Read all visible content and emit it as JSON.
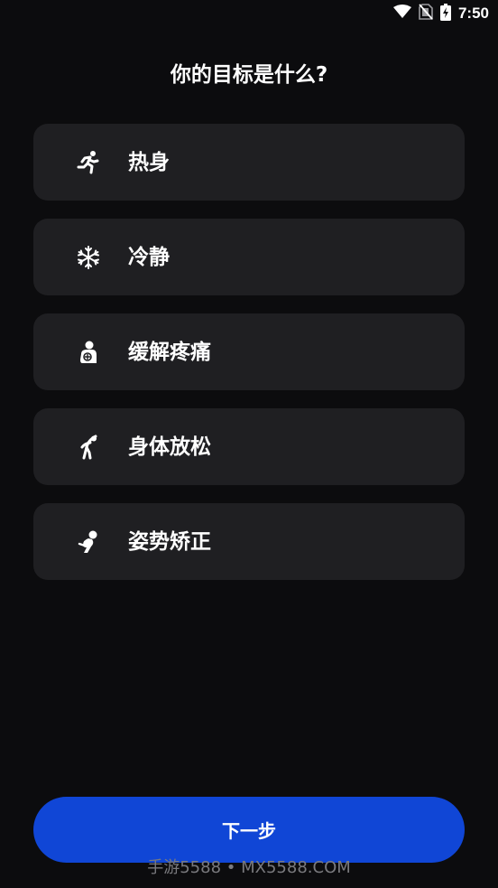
{
  "status_bar": {
    "time": "7:50",
    "icons": [
      "wifi-icon",
      "no-sim-icon",
      "battery-charging-icon"
    ]
  },
  "title": "你的目标是什么?",
  "options": [
    {
      "label": "热身",
      "icon": "running-icon"
    },
    {
      "label": "冷静",
      "icon": "snowflake-icon"
    },
    {
      "label": "缓解疼痛",
      "icon": "pain-relief-icon"
    },
    {
      "label": "身体放松",
      "icon": "stretch-icon"
    },
    {
      "label": "姿势矫正",
      "icon": "posture-icon"
    }
  ],
  "next_button_label": "下一步",
  "watermark": "手游5588 • MX5588.COM",
  "colors": {
    "background": "#0c0c0e",
    "card": "#1f1f22",
    "accent": "#1046d6",
    "text": "#ffffff"
  }
}
